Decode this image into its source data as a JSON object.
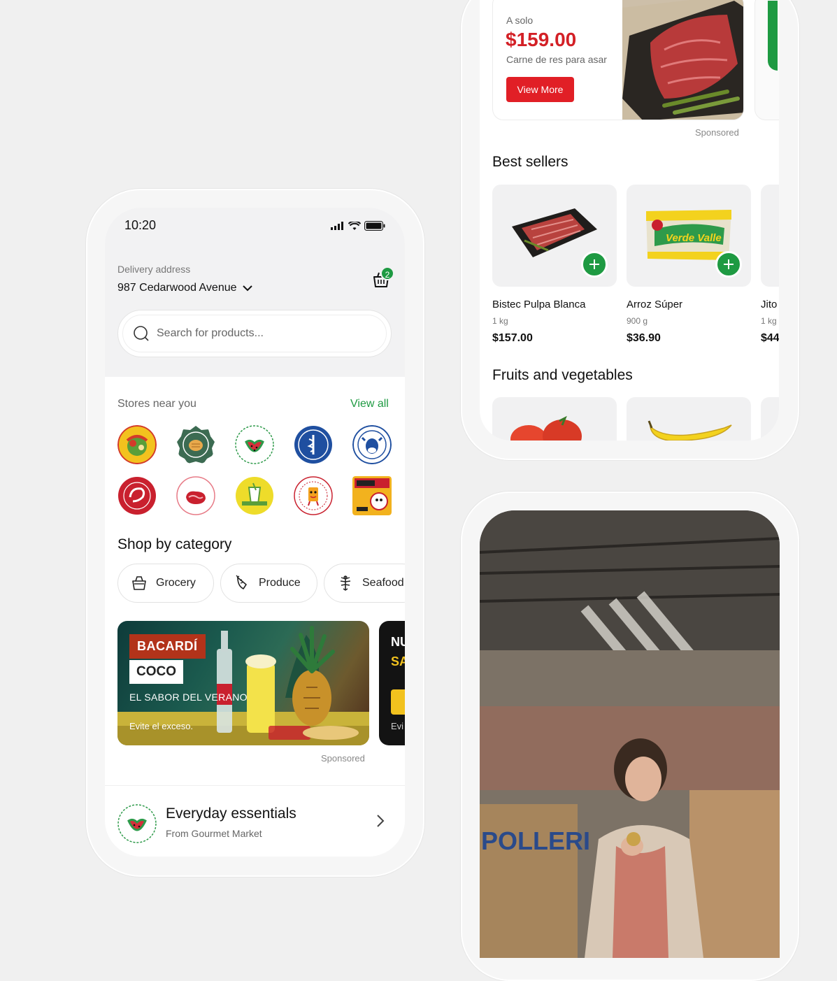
{
  "status_bar": {
    "time": "10:20"
  },
  "header": {
    "delivery_label": "Delivery address",
    "address": "987 Cedarwood Avenue",
    "cart_count": "2"
  },
  "search": {
    "placeholder": "Search for products..."
  },
  "stores": {
    "title": "Stores near you",
    "view_all": "View all",
    "logos": [
      {
        "name": "farmers-salad",
        "colors": [
          "#f3c21e",
          "#d33a2a",
          "#5a9e3a"
        ]
      },
      {
        "name": "shah-bread",
        "colors": [
          "#3c6b52",
          "#e9a94b",
          "#ffffff"
        ]
      },
      {
        "name": "rimberio",
        "colors": [
          "#ffffff",
          "#d62e3a",
          "#2e9a4a"
        ]
      },
      {
        "name": "borcelle-medical",
        "colors": [
          "#1f4fa0",
          "#ffffff",
          "#ffffff"
        ]
      },
      {
        "name": "jiwan-dairy",
        "colors": [
          "#ffffff",
          "#1f4fa0",
          "#1f4fa0"
        ]
      },
      {
        "name": "fresh-shrimp",
        "colors": [
          "#c9202e",
          "#ffffff",
          "#ffffff"
        ]
      },
      {
        "name": "larana-inc",
        "colors": [
          "#ffffff",
          "#c9202e",
          "#e77a86"
        ]
      },
      {
        "name": "fresh-drink",
        "colors": [
          "#eedc2a",
          "#5a9e3a",
          "#ffffff"
        ]
      },
      {
        "name": "delicious-snacks",
        "colors": [
          "#ffffff",
          "#c9202e",
          "#f3a11e"
        ]
      },
      {
        "name": "fine-wine",
        "colors": [
          "#f2b21e",
          "#c9202e",
          "#222222"
        ]
      }
    ]
  },
  "categories": {
    "title": "Shop by category",
    "items": [
      {
        "label": "Grocery",
        "icon": "basket-icon"
      },
      {
        "label": "Produce",
        "icon": "carrot-icon"
      },
      {
        "label": "Seafood",
        "icon": "fish-icon"
      }
    ]
  },
  "promo": {
    "brand": "BACARDÍ",
    "flavor": "COCO",
    "tagline": "EL SABOR DEL VERANO",
    "warning": "Evite el exceso.",
    "next_line1": "NU",
    "next_line2": "SA",
    "next_warning": "Evi",
    "sponsored": "Sponsored"
  },
  "essentials": {
    "title": "Everyday essentials",
    "subtitle": "From Gourmet Market"
  },
  "ad": {
    "pre": "A solo",
    "price": "$159.00",
    "desc": "Carne de res para asar",
    "button": "View More",
    "sponsored": "Sponsored"
  },
  "best_sellers": {
    "title": "Best sellers",
    "items": [
      {
        "name": "Bistec Pulpa Blanca",
        "size": "1 kg",
        "price": "$157.00"
      },
      {
        "name": "Arroz Súper",
        "size": "900 g",
        "price": "$36.90",
        "package_brand": "Verde Valle"
      },
      {
        "name": "Jito",
        "size": "1 kg",
        "price": "$44"
      }
    ]
  },
  "fruits": {
    "title": "Fruits and vegetables"
  },
  "market_photo": {
    "sign": "POLLERI"
  },
  "colors": {
    "accent_green": "#1e9a42",
    "accent_red": "#e11f26",
    "price_red": "#d32026"
  }
}
